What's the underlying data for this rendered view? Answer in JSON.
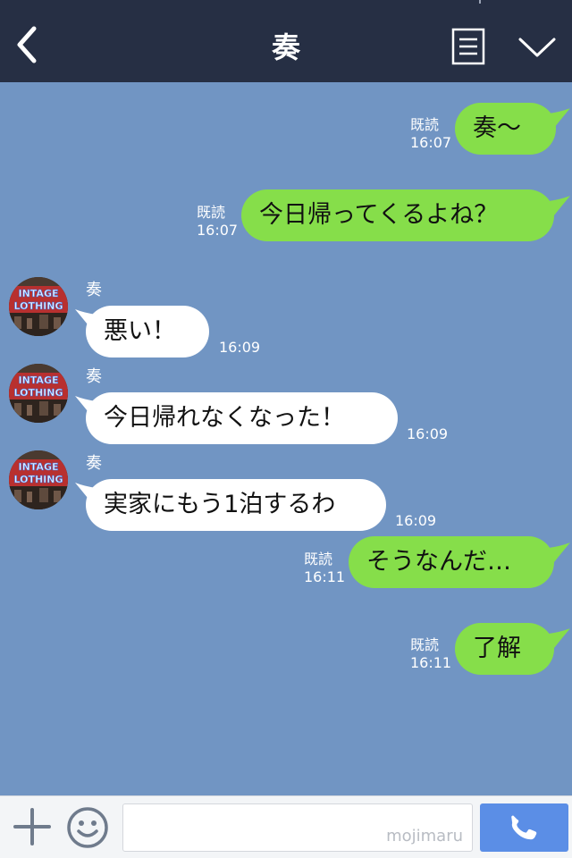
{
  "header": {
    "title": "奏"
  },
  "messages": [
    {
      "side": "right",
      "text": "奏〜",
      "read": "既読",
      "time": "16:07"
    },
    {
      "side": "right",
      "text": "今日帰ってくるよね？",
      "read": "既読",
      "time": "16:07"
    },
    {
      "side": "left",
      "sender": "奏",
      "text": "悪い！",
      "time": "16:09"
    },
    {
      "side": "left",
      "sender": "奏",
      "text": "今日帰れなくなった！",
      "time": "16:09"
    },
    {
      "side": "left",
      "sender": "奏",
      "text": "実家にもう1泊するわ",
      "time": "16:09"
    },
    {
      "side": "right",
      "text": "そうなんだ…",
      "read": "既読",
      "time": "16:11"
    },
    {
      "side": "right",
      "text": "了解",
      "read": "既読",
      "time": "16:11"
    }
  ],
  "avatar_text": [
    "INTAGE",
    "LOTHING"
  ],
  "input": {
    "placeholder": "",
    "watermark": "mojimaru"
  },
  "colors": {
    "header_bg": "#262f44",
    "chat_bg": "#7195c3",
    "sent_bubble": "#86de4a",
    "received_bubble": "#ffffff",
    "call_button": "#5b8ee6"
  },
  "icons": {
    "back": "chevron-left-icon",
    "menu": "menu-list-icon",
    "collapse": "chevron-down-icon",
    "add": "plus-icon",
    "emoji": "smiley-icon",
    "call": "phone-icon"
  }
}
